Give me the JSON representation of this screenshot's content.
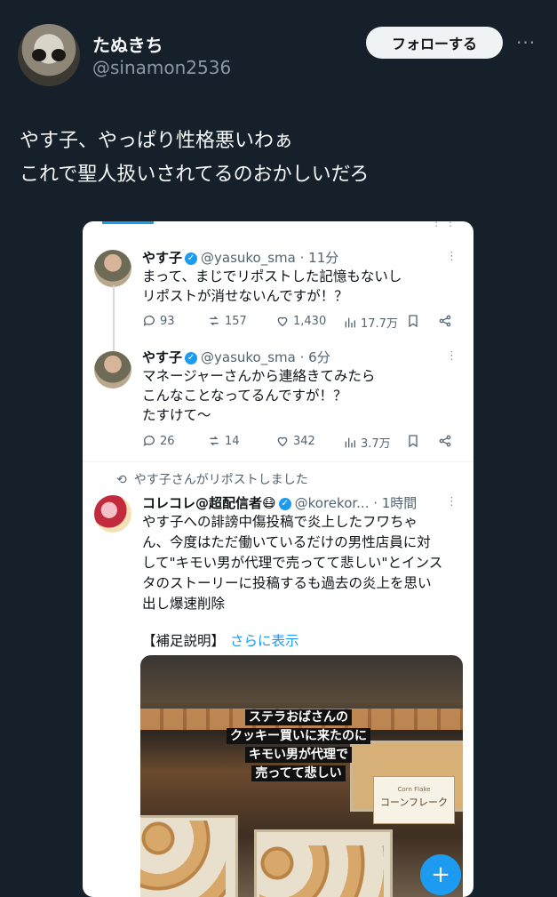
{
  "author": {
    "name": "たぬきち",
    "handle": "@sinamon2536",
    "follow_label": "フォローする",
    "more_glyph": "···"
  },
  "tweet_lines": [
    "やす子、やっぱり性格悪いわぁ",
    "これで聖人扱いされてるのおかしいだろ"
  ],
  "screenshot": {
    "posts": [
      {
        "name": "やす子",
        "handle": "@yasuko_sma · 11分",
        "lines": [
          "まって、まじでリポストした記憶もないし",
          "リポストが消せないんですが！？"
        ],
        "replies": "93",
        "reposts": "157",
        "likes": "1,430",
        "views": "17.7万"
      },
      {
        "name": "やす子",
        "handle": "@yasuko_sma · 6分",
        "lines": [
          "マネージャーさんから連絡きてみたら",
          "こんなことなってるんですが！？",
          "たすけて〜"
        ],
        "replies": "26",
        "reposts": "14",
        "likes": "342",
        "views": "3.7万"
      }
    ],
    "repost_notice": "やす子さんがリポストしました",
    "reposted": {
      "name": "コレコレ@超配信者😷",
      "handle": "@korekor... · 1時間",
      "lines": [
        "やす子への誹謗中傷投稿で炎上したフワちゃ",
        "ん、今度はただ働いているだけの男性店員に対",
        "して\"キモい男が代理で売ってて悲しい\"とインス",
        "タのストーリーに投稿するも過去の炎上を思い",
        "出し爆速削除"
      ],
      "supplement": "【補足説明】",
      "show_more": "さらに表示",
      "image_caption": [
        "ステラおばさんの",
        "クッキー買いに来たのに",
        "キモい男が代理で",
        "売ってて悲しい"
      ],
      "card_small": "Corn Flake",
      "card_label": "コーンフレーク"
    }
  },
  "fab_label": "+",
  "colors": {
    "background": "#15202b",
    "accent": "#1d9bf0"
  }
}
